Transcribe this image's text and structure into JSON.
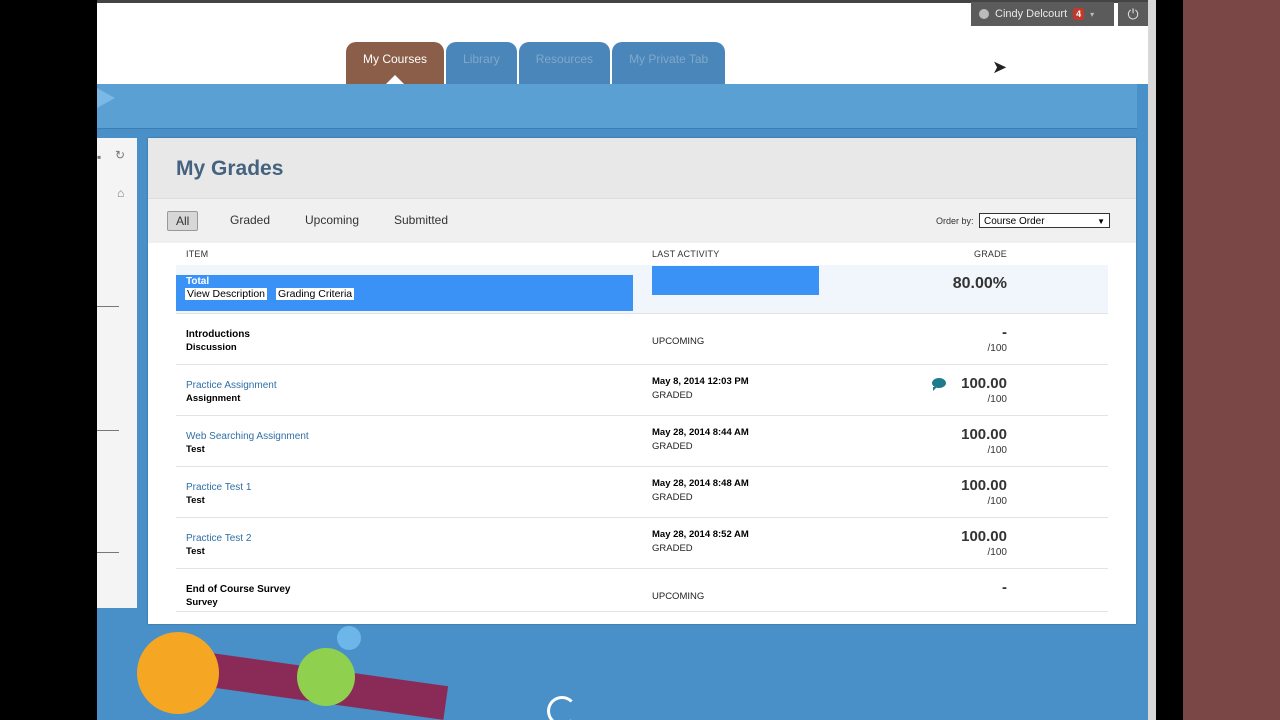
{
  "header": {
    "user_name": "Cindy Delcourt",
    "notification_count": "4",
    "tabs": [
      {
        "label": "My Courses"
      },
      {
        "label": "Library"
      },
      {
        "label": "Resources"
      },
      {
        "label": "My Private Tab"
      }
    ]
  },
  "page": {
    "title": "My Grades",
    "filters": [
      "All",
      "Graded",
      "Upcoming",
      "Submitted"
    ],
    "order_label": "Order by:",
    "order_value": "Course Order"
  },
  "columns": {
    "item": "ITEM",
    "activity": "LAST ACTIVITY",
    "grade": "GRADE"
  },
  "total": {
    "label": "Total",
    "view_description": "View Description",
    "grading_criteria": "Grading Criteria",
    "grade": "80.00%"
  },
  "rows": [
    {
      "title": "Introductions",
      "type": "Discussion",
      "date": "",
      "status": "UPCOMING",
      "grade": "-",
      "denominator": "/100"
    },
    {
      "title": "Practice Assignment",
      "type": "Assignment",
      "date": "May 8, 2014 12:03 PM",
      "status": "GRADED",
      "grade": "100.00",
      "denominator": "/100"
    },
    {
      "title": "Web Searching Assignment",
      "type": "Test",
      "date": "May 28, 2014 8:44 AM",
      "status": "GRADED",
      "grade": "100.00",
      "denominator": "/100"
    },
    {
      "title": "Practice Test 1",
      "type": "Test",
      "date": "May 28, 2014 8:48 AM",
      "status": "GRADED",
      "grade": "100.00",
      "denominator": "/100"
    },
    {
      "title": "Practice Test 2",
      "type": "Test",
      "date": "May 28, 2014 8:52 AM",
      "status": "GRADED",
      "grade": "100.00",
      "denominator": "/100"
    },
    {
      "title": "End of Course Survey",
      "type": "Survey",
      "date": "",
      "status": "UPCOMING",
      "grade": "-",
      "denominator": ""
    }
  ],
  "colors": {
    "active_tab": "#8b5e49",
    "selection": "#3a92f7",
    "title": "#45627f",
    "link": "#2f6fa6"
  }
}
